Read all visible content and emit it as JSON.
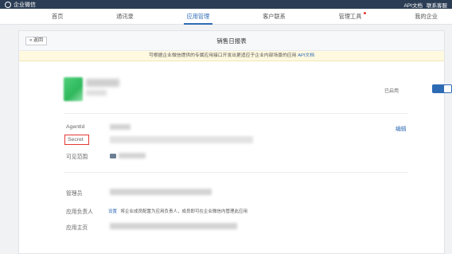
{
  "topbar": {
    "brand": "企业微信",
    "links": [
      "API文档",
      "联系客服"
    ]
  },
  "nav": {
    "items": [
      {
        "label": "首页",
        "active": false
      },
      {
        "label": "通讯录",
        "active": false
      },
      {
        "label": "应用管理",
        "active": true
      },
      {
        "label": "客户联系",
        "active": false
      },
      {
        "label": "管理工具",
        "active": false,
        "badge": true
      },
      {
        "label": "我的企业",
        "active": false
      }
    ]
  },
  "panel": {
    "back_label": "« 返回",
    "title": "销售日报表"
  },
  "notice": {
    "text": "可根据企业微信提供的专属应用接口开发出更适应于企业内部场景的应用",
    "link": "API文档"
  },
  "app": {
    "toggle_label": "已启用",
    "enabled": true
  },
  "fields": {
    "agentid_label": "AgentId",
    "secret_label": "Secret",
    "scope_label": "可见范围",
    "edit_label": "编辑",
    "admin_label": "管理员",
    "owner_label": "应用负责人",
    "owner_tag": "设置",
    "owner_hint": "将企业成员配置为应用负责人，成员即可在企业微信内管理此应用",
    "homepage_label": "应用主页"
  },
  "colors": {
    "accent": "#2e6bb5",
    "topbar": "#2b3d55",
    "highlight": "#e53935",
    "notice_bg": "#fff9e0"
  }
}
